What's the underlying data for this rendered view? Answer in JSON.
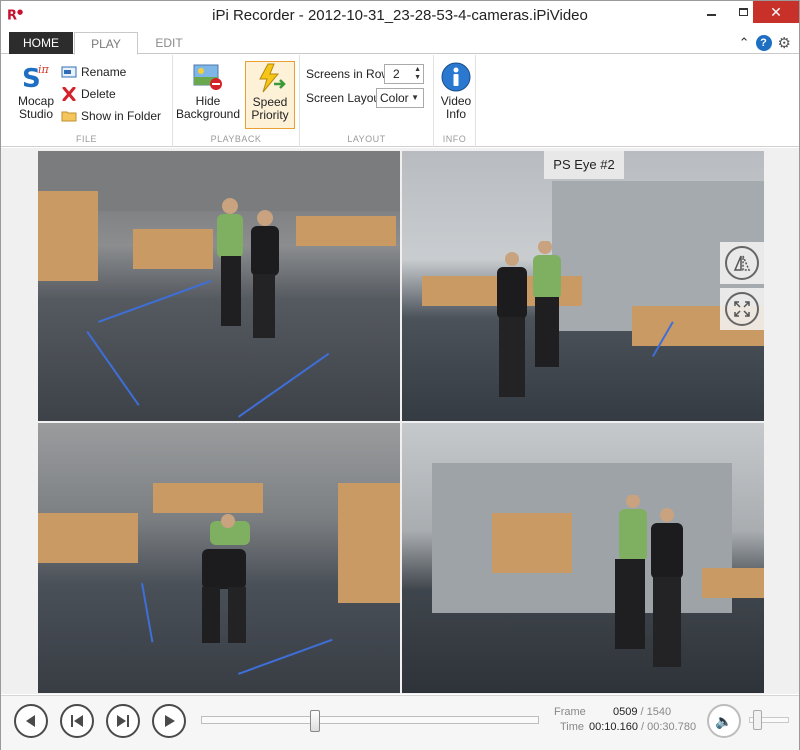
{
  "window": {
    "logo": "R",
    "title": "iPi Recorder - 2012-10-31_23-28-53-4-cameras.iPiVideo"
  },
  "tabs": [
    {
      "label": "HOME",
      "active": true
    },
    {
      "label": "PLAY",
      "active": false
    },
    {
      "label": "EDIT",
      "active": false
    }
  ],
  "ribbon": {
    "file": {
      "group_label": "FILE",
      "mocap_label_1": "Mocap",
      "mocap_label_2": "Studio",
      "rename": "Rename",
      "delete": "Delete",
      "show_in_folder": "Show in Folder"
    },
    "playback": {
      "group_label": "PLAYBACK",
      "hide_bg_1": "Hide",
      "hide_bg_2": "Background",
      "speed_1": "Speed",
      "speed_2": "Priority"
    },
    "layout": {
      "group_label": "LAYOUT",
      "screens_in_row_label": "Screens in Row",
      "screens_in_row_value": "2",
      "screen_layout_label": "Screen Layout",
      "screen_layout_value": "Color"
    },
    "info": {
      "group_label": "INFO",
      "video_info_1": "Video",
      "video_info_2": "Info"
    }
  },
  "video": {
    "hover_camera_label": "PS Eye #2",
    "cameras": [
      {
        "id": "cam1"
      },
      {
        "id": "cam2"
      },
      {
        "id": "cam3"
      },
      {
        "id": "cam4"
      }
    ]
  },
  "transport": {
    "frame_label": "Frame",
    "frame_current": "0509",
    "frame_total": "1540",
    "time_label": "Time",
    "time_current": "00:10.160",
    "time_total": "00:30.780",
    "seek_position": 0.33,
    "volume_position": 0.1
  },
  "colors": {
    "accent_close": "#c7312a",
    "tab_active_bg": "#2c2c2c",
    "highlight_border": "#e8a035",
    "floor_markers": "#3e6fd8"
  }
}
